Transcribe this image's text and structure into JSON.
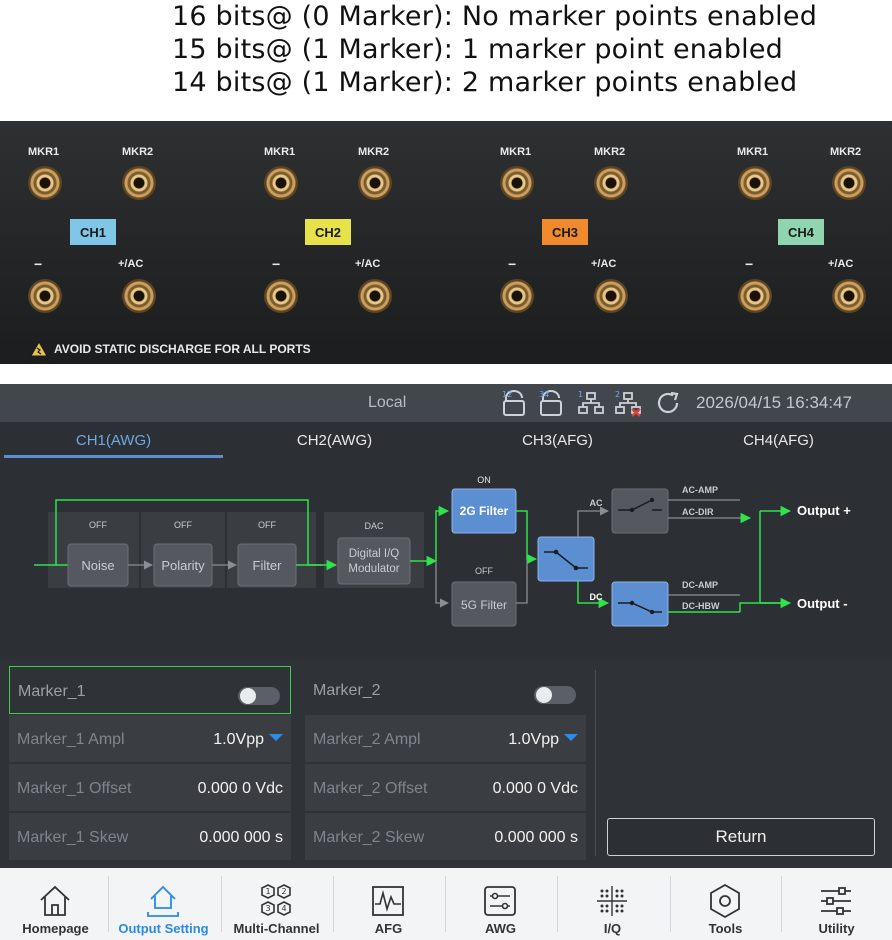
{
  "notes": [
    "16 bits@ (0 Marker): No marker points enabled",
    "15 bits@ (1 Marker): 1 marker point enabled",
    "14 bits@ (1 Marker): 2 marker points enabled"
  ],
  "panel": {
    "channels": [
      {
        "badge": "CH1",
        "color": "#7fc6e8",
        "mkr1": "MKR1",
        "mkr2": "MKR2",
        "neg": "−",
        "pos": "+/AC"
      },
      {
        "badge": "CH2",
        "color": "#e7e24a",
        "mkr1": "MKR1",
        "mkr2": "MKR2",
        "neg": "−",
        "pos": "+/AC"
      },
      {
        "badge": "CH3",
        "color": "#f08a2c",
        "mkr1": "MKR1",
        "mkr2": "MKR2",
        "neg": "−",
        "pos": "+/AC"
      },
      {
        "badge": "CH4",
        "color": "#8fd6b0",
        "mkr1": "MKR1",
        "mkr2": "MKR2",
        "neg": "−",
        "pos": "+/AC"
      }
    ],
    "warning": "AVOID STATIC DISCHARGE FOR ALL PORTS"
  },
  "status": {
    "mode": "Local",
    "datetime": "2026/04/15  16:34:47",
    "icon_badges": [
      "12",
      "34",
      "1",
      "2"
    ]
  },
  "tabs": [
    {
      "label": "CH1(AWG)",
      "active": true
    },
    {
      "label": "CH2(AWG)",
      "active": false
    },
    {
      "label": "CH3(AFG)",
      "active": false
    },
    {
      "label": "CH4(AFG)",
      "active": false
    }
  ],
  "diagram": {
    "blocks": [
      {
        "state": "OFF",
        "label": "Noise"
      },
      {
        "state": "OFF",
        "label": "Polarity"
      },
      {
        "state": "OFF",
        "label": "Filter"
      }
    ],
    "dac": {
      "state": "DAC",
      "line1": "Digital I/Q",
      "line2": "Modulator"
    },
    "filter_2g": {
      "state": "ON",
      "label": "2G Filter"
    },
    "filter_5g": {
      "state": "OFF",
      "label": "5G Filter"
    },
    "ac_label": "AC",
    "dc_label": "DC",
    "ac_amp": "AC-AMP",
    "ac_dir": "AC-DIR",
    "dc_amp": "DC-AMP",
    "dc_hbw": "DC-HBW",
    "out_pos": "Output +",
    "out_neg": "Output -",
    "colors": {
      "path": "#2fe34a",
      "active_block": "#5b8fd1"
    }
  },
  "marker1": {
    "title": "Marker_1",
    "enabled": false,
    "ampl_label": "Marker_1 Ampl",
    "ampl_value": "1.0Vpp",
    "offset_label": "Marker_1 Offset",
    "offset_value": "0.000 0  Vdc",
    "skew_label": "Marker_1 Skew",
    "skew_value": "0.000 000  s"
  },
  "marker2": {
    "title": "Marker_2",
    "enabled": false,
    "ampl_label": "Marker_2 Ampl",
    "ampl_value": "1.0Vpp",
    "offset_label": "Marker_2 Offset",
    "offset_value": "0.000 0  Vdc",
    "skew_label": "Marker_2 Skew",
    "skew_value": "0.000 000  s"
  },
  "return_label": "Return",
  "nav": [
    {
      "label": "Homepage",
      "icon": "home-icon",
      "active": false
    },
    {
      "label": "Output Setting",
      "icon": "output-setting-icon",
      "active": true
    },
    {
      "label": "Multi-Channel",
      "icon": "multi-channel-icon",
      "active": false
    },
    {
      "label": "AFG",
      "icon": "afg-icon",
      "active": false
    },
    {
      "label": "AWG",
      "icon": "awg-icon",
      "active": false
    },
    {
      "label": "I/Q",
      "icon": "iq-icon",
      "active": false
    },
    {
      "label": "Tools",
      "icon": "tools-icon",
      "active": false
    },
    {
      "label": "Utility",
      "icon": "utility-icon",
      "active": false
    }
  ]
}
